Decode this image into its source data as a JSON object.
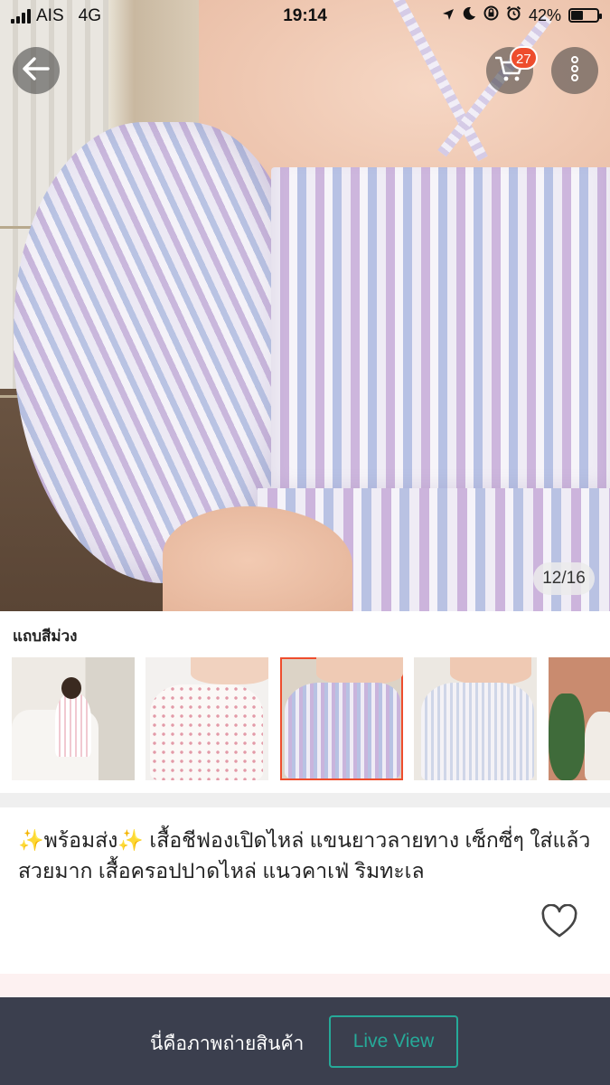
{
  "status_bar": {
    "carrier": "AIS",
    "network": "4G",
    "time": "19:14",
    "battery": "42%",
    "battery_level": 0.42
  },
  "header": {
    "back_icon": "arrow-left-icon",
    "cart_icon": "shopping-cart-icon",
    "cart_count": "27",
    "more_icon": "vertical-dots-icon"
  },
  "gallery": {
    "counter": "12/16"
  },
  "variation": {
    "label": "แถบสีม่วง",
    "options": [
      {
        "name": "option-1",
        "selected": false
      },
      {
        "name": "option-2",
        "selected": false
      },
      {
        "name": "option-3",
        "selected": true
      },
      {
        "name": "option-4",
        "selected": false
      },
      {
        "name": "option-5",
        "selected": false
      }
    ]
  },
  "product": {
    "title": "✨พร้อมส่ง✨  เสื้อชีฟองเปิดไหล่ แขนยาวลายทาง  เซ็กซี่ๆ ใส่แล้วสวยมาก  เสื้อครอปปาดไหล่ แนวคาเฟ่  ริมทะเล",
    "like_icon": "heart-outline-icon"
  },
  "bottom_bar": {
    "photo_text": "นี่คือภาพถ่ายสินค้า",
    "live_view_label": "Live View"
  },
  "colors": {
    "accent": "#ee4d2d",
    "live_view": "#26aa99",
    "bottom_bar_bg": "#3b3f4e"
  }
}
